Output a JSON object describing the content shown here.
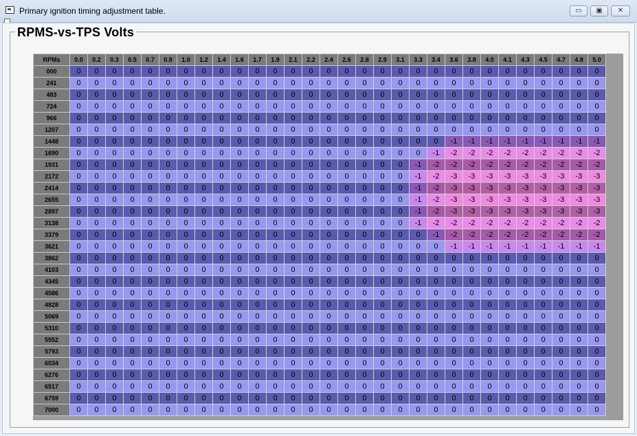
{
  "window": {
    "title": "Primary ignition timing adjustment table.",
    "min_glyph": "▭",
    "max_glyph": "▣",
    "close_glyph": "✕"
  },
  "group": {
    "title": "RPMS-vs-TPS Volts"
  },
  "table": {
    "corner_label": "RPMs",
    "columns": [
      "0.0",
      "0.2",
      "0.3",
      "0.5",
      "0.7",
      "0.9",
      "1.0",
      "1.2",
      "1.4",
      "1.6",
      "1.7",
      "1.9",
      "2.1",
      "2.2",
      "2.4",
      "2.6",
      "2.8",
      "2.9",
      "3.1",
      "3.3",
      "3.4",
      "3.6",
      "3.8",
      "4.0",
      "4.1",
      "4.3",
      "4.5",
      "4.7",
      "4.8",
      "5.0"
    ],
    "rows": [
      {
        "rpm": "000",
        "values": [
          0,
          0,
          0,
          0,
          0,
          0,
          0,
          0,
          0,
          0,
          0,
          0,
          0,
          0,
          0,
          0,
          0,
          0,
          0,
          0,
          0,
          0,
          0,
          0,
          0,
          0,
          0,
          0,
          0,
          0
        ]
      },
      {
        "rpm": "241",
        "values": [
          0,
          0,
          0,
          0,
          0,
          0,
          0,
          0,
          0,
          0,
          0,
          0,
          0,
          0,
          0,
          0,
          0,
          0,
          0,
          0,
          0,
          0,
          0,
          0,
          0,
          0,
          0,
          0,
          0,
          0
        ]
      },
      {
        "rpm": "483",
        "values": [
          0,
          0,
          0,
          0,
          0,
          0,
          0,
          0,
          0,
          0,
          0,
          0,
          0,
          0,
          0,
          0,
          0,
          0,
          0,
          0,
          0,
          0,
          0,
          0,
          0,
          0,
          0,
          0,
          0,
          0
        ]
      },
      {
        "rpm": "724",
        "values": [
          0,
          0,
          0,
          0,
          0,
          0,
          0,
          0,
          0,
          0,
          0,
          0,
          0,
          0,
          0,
          0,
          0,
          0,
          0,
          0,
          0,
          0,
          0,
          0,
          0,
          0,
          0,
          0,
          0,
          0
        ]
      },
      {
        "rpm": "966",
        "values": [
          0,
          0,
          0,
          0,
          0,
          0,
          0,
          0,
          0,
          0,
          0,
          0,
          0,
          0,
          0,
          0,
          0,
          0,
          0,
          0,
          0,
          0,
          0,
          0,
          0,
          0,
          0,
          0,
          0,
          0
        ]
      },
      {
        "rpm": "1207",
        "values": [
          0,
          0,
          0,
          0,
          0,
          0,
          0,
          0,
          0,
          0,
          0,
          0,
          0,
          0,
          0,
          0,
          0,
          0,
          0,
          0,
          0,
          0,
          0,
          0,
          0,
          0,
          0,
          0,
          0,
          0
        ]
      },
      {
        "rpm": "1448",
        "values": [
          0,
          0,
          0,
          0,
          0,
          0,
          0,
          0,
          0,
          0,
          0,
          0,
          0,
          0,
          0,
          0,
          0,
          0,
          0,
          0,
          0,
          -1,
          -1,
          -1,
          -1,
          -1,
          -1,
          -1,
          -1,
          -1
        ]
      },
      {
        "rpm": "1690",
        "values": [
          0,
          0,
          0,
          0,
          0,
          0,
          0,
          0,
          0,
          0,
          0,
          0,
          0,
          0,
          0,
          0,
          0,
          0,
          0,
          0,
          -1,
          -2,
          -2,
          -2,
          -2,
          -2,
          -2,
          -2,
          -2,
          -2
        ]
      },
      {
        "rpm": "1931",
        "values": [
          0,
          0,
          0,
          0,
          0,
          0,
          0,
          0,
          0,
          0,
          0,
          0,
          0,
          0,
          0,
          0,
          0,
          0,
          0,
          -1,
          -2,
          -2,
          -2,
          -2,
          -2,
          -2,
          -2,
          -2,
          -2,
          -2
        ]
      },
      {
        "rpm": "2172",
        "values": [
          0,
          0,
          0,
          0,
          0,
          0,
          0,
          0,
          0,
          0,
          0,
          0,
          0,
          0,
          0,
          0,
          0,
          0,
          0,
          -1,
          -2,
          -3,
          -3,
          -3,
          -3,
          -3,
          -3,
          -3,
          -3,
          -3
        ]
      },
      {
        "rpm": "2414",
        "values": [
          0,
          0,
          0,
          0,
          0,
          0,
          0,
          0,
          0,
          0,
          0,
          0,
          0,
          0,
          0,
          0,
          0,
          0,
          0,
          -1,
          -2,
          -3,
          -3,
          -3,
          -3,
          -3,
          -3,
          -3,
          -3,
          -3
        ]
      },
      {
        "rpm": "2655",
        "values": [
          0,
          0,
          0,
          0,
          0,
          0,
          0,
          0,
          0,
          0,
          0,
          0,
          0,
          0,
          0,
          0,
          0,
          0,
          0,
          -1,
          -2,
          -3,
          -3,
          -3,
          -3,
          -3,
          -3,
          -3,
          -3,
          -3
        ]
      },
      {
        "rpm": "2897",
        "values": [
          0,
          0,
          0,
          0,
          0,
          0,
          0,
          0,
          0,
          0,
          0,
          0,
          0,
          0,
          0,
          0,
          0,
          0,
          0,
          -1,
          -2,
          -3,
          -3,
          -3,
          -3,
          -3,
          -3,
          -3,
          -3,
          -3
        ]
      },
      {
        "rpm": "3138",
        "values": [
          0,
          0,
          0,
          0,
          0,
          0,
          0,
          0,
          0,
          0,
          0,
          0,
          0,
          0,
          0,
          0,
          0,
          0,
          0,
          -1,
          -2,
          -2,
          -2,
          -2,
          -2,
          -2,
          -2,
          -2,
          -2,
          -2
        ]
      },
      {
        "rpm": "3379",
        "values": [
          0,
          0,
          0,
          0,
          0,
          0,
          0,
          0,
          0,
          0,
          0,
          0,
          0,
          0,
          0,
          0,
          0,
          0,
          0,
          0,
          -1,
          -2,
          -2,
          -2,
          -2,
          -2,
          -2,
          -2,
          -2,
          -2
        ]
      },
      {
        "rpm": "3621",
        "values": [
          0,
          0,
          0,
          0,
          0,
          0,
          0,
          0,
          0,
          0,
          0,
          0,
          0,
          0,
          0,
          0,
          0,
          0,
          0,
          0,
          0,
          -1,
          -1,
          -1,
          -1,
          -1,
          -1,
          -1,
          -1,
          -1
        ]
      },
      {
        "rpm": "3862",
        "values": [
          0,
          0,
          0,
          0,
          0,
          0,
          0,
          0,
          0,
          0,
          0,
          0,
          0,
          0,
          0,
          0,
          0,
          0,
          0,
          0,
          0,
          0,
          0,
          0,
          0,
          0,
          0,
          0,
          0,
          0
        ]
      },
      {
        "rpm": "4103",
        "values": [
          0,
          0,
          0,
          0,
          0,
          0,
          0,
          0,
          0,
          0,
          0,
          0,
          0,
          0,
          0,
          0,
          0,
          0,
          0,
          0,
          0,
          0,
          0,
          0,
          0,
          0,
          0,
          0,
          0,
          0
        ]
      },
      {
        "rpm": "4345",
        "values": [
          0,
          0,
          0,
          0,
          0,
          0,
          0,
          0,
          0,
          0,
          0,
          0,
          0,
          0,
          0,
          0,
          0,
          0,
          0,
          0,
          0,
          0,
          0,
          0,
          0,
          0,
          0,
          0,
          0,
          0
        ]
      },
      {
        "rpm": "4586",
        "values": [
          0,
          0,
          0,
          0,
          0,
          0,
          0,
          0,
          0,
          0,
          0,
          0,
          0,
          0,
          0,
          0,
          0,
          0,
          0,
          0,
          0,
          0,
          0,
          0,
          0,
          0,
          0,
          0,
          0,
          0
        ]
      },
      {
        "rpm": "4828",
        "values": [
          0,
          0,
          0,
          0,
          0,
          0,
          0,
          0,
          0,
          0,
          0,
          0,
          0,
          0,
          0,
          0,
          0,
          0,
          0,
          0,
          0,
          0,
          0,
          0,
          0,
          0,
          0,
          0,
          0,
          0
        ]
      },
      {
        "rpm": "5069",
        "values": [
          0,
          0,
          0,
          0,
          0,
          0,
          0,
          0,
          0,
          0,
          0,
          0,
          0,
          0,
          0,
          0,
          0,
          0,
          0,
          0,
          0,
          0,
          0,
          0,
          0,
          0,
          0,
          0,
          0,
          0
        ]
      },
      {
        "rpm": "5310",
        "values": [
          0,
          0,
          0,
          0,
          0,
          0,
          0,
          0,
          0,
          0,
          0,
          0,
          0,
          0,
          0,
          0,
          0,
          0,
          0,
          0,
          0,
          0,
          0,
          0,
          0,
          0,
          0,
          0,
          0,
          0
        ]
      },
      {
        "rpm": "5552",
        "values": [
          0,
          0,
          0,
          0,
          0,
          0,
          0,
          0,
          0,
          0,
          0,
          0,
          0,
          0,
          0,
          0,
          0,
          0,
          0,
          0,
          0,
          0,
          0,
          0,
          0,
          0,
          0,
          0,
          0,
          0
        ]
      },
      {
        "rpm": "5793",
        "values": [
          0,
          0,
          0,
          0,
          0,
          0,
          0,
          0,
          0,
          0,
          0,
          0,
          0,
          0,
          0,
          0,
          0,
          0,
          0,
          0,
          0,
          0,
          0,
          0,
          0,
          0,
          0,
          0,
          0,
          0
        ]
      },
      {
        "rpm": "6034",
        "values": [
          0,
          0,
          0,
          0,
          0,
          0,
          0,
          0,
          0,
          0,
          0,
          0,
          0,
          0,
          0,
          0,
          0,
          0,
          0,
          0,
          0,
          0,
          0,
          0,
          0,
          0,
          0,
          0,
          0,
          0
        ]
      },
      {
        "rpm": "6276",
        "values": [
          0,
          0,
          0,
          0,
          0,
          0,
          0,
          0,
          0,
          0,
          0,
          0,
          0,
          0,
          0,
          0,
          0,
          0,
          0,
          0,
          0,
          0,
          0,
          0,
          0,
          0,
          0,
          0,
          0,
          0
        ]
      },
      {
        "rpm": "6517",
        "values": [
          0,
          0,
          0,
          0,
          0,
          0,
          0,
          0,
          0,
          0,
          0,
          0,
          0,
          0,
          0,
          0,
          0,
          0,
          0,
          0,
          0,
          0,
          0,
          0,
          0,
          0,
          0,
          0,
          0,
          0
        ]
      },
      {
        "rpm": "6759",
        "values": [
          0,
          0,
          0,
          0,
          0,
          0,
          0,
          0,
          0,
          0,
          0,
          0,
          0,
          0,
          0,
          0,
          0,
          0,
          0,
          0,
          0,
          0,
          0,
          0,
          0,
          0,
          0,
          0,
          0,
          0
        ]
      },
      {
        "rpm": "7000",
        "values": [
          0,
          0,
          0,
          0,
          0,
          0,
          0,
          0,
          0,
          0,
          0,
          0,
          0,
          0,
          0,
          0,
          0,
          0,
          0,
          0,
          0,
          0,
          0,
          0,
          0,
          0,
          0,
          0,
          0,
          0
        ]
      }
    ]
  }
}
